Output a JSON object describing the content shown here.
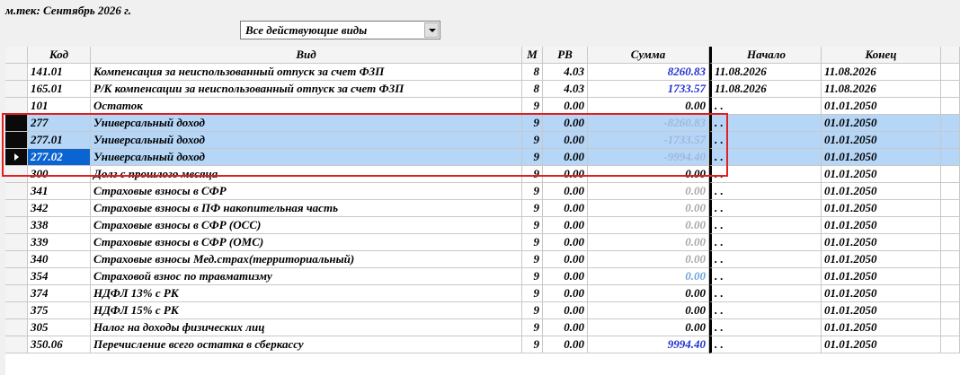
{
  "header": {
    "title": "м.тек: Сентябрь 2026 г."
  },
  "filter": {
    "selected": "Все действующие виды"
  },
  "columns": {
    "kod": "Код",
    "vid": "Вид",
    "m": "М",
    "rv": "РВ",
    "summa": "Сумма",
    "nachalo": "Начало",
    "konec": "Конец"
  },
  "rows": [
    {
      "kod": "141.01",
      "vid": "Компенсация за неиспользованный отпуск за счет ФЗП",
      "m": "8",
      "rv": "4.03",
      "summa": "8260.83",
      "nachalo": "11.08.2026",
      "konec": "11.08.2026"
    },
    {
      "kod": "165.01",
      "vid": "Р/К компенсации за неиспользованный отпуск за счет ФЗП",
      "m": "8",
      "rv": "4.03",
      "summa": "1733.57",
      "nachalo": "11.08.2026",
      "konec": "11.08.2026"
    },
    {
      "kod": "101",
      "vid": "Остаток",
      "m": "9",
      "rv": "0.00",
      "summa": "0.00",
      "nachalo": ". .",
      "konec": "01.01.2050"
    },
    {
      "kod": "277",
      "vid": "Универсальный доход",
      "m": "9",
      "rv": "0.00",
      "summa": "-8260.83",
      "nachalo": ". .",
      "konec": "01.01.2050"
    },
    {
      "kod": "277.01",
      "vid": "Универсальный доход",
      "m": "9",
      "rv": "0.00",
      "summa": "-1733.57",
      "nachalo": ". .",
      "konec": "01.01.2050"
    },
    {
      "kod": "277.02",
      "vid": "Универсальный доход",
      "m": "9",
      "rv": "0.00",
      "summa": "-9994.40",
      "nachalo": ". .",
      "konec": "01.01.2050"
    },
    {
      "kod": "300",
      "vid": "Долг с прошлого месяца",
      "m": "9",
      "rv": "0.00",
      "summa": "0.00",
      "nachalo": ". .",
      "konec": "01.01.2050"
    },
    {
      "kod": "341",
      "vid": "Страховые взносы в СФР",
      "m": "9",
      "rv": "0.00",
      "summa": "0.00",
      "nachalo": ". .",
      "konec": "01.01.2050"
    },
    {
      "kod": "342",
      "vid": "Страховые взносы в ПФ накопительная часть",
      "m": "9",
      "rv": "0.00",
      "summa": "0.00",
      "nachalo": ". .",
      "konec": "01.01.2050"
    },
    {
      "kod": "338",
      "vid": "Страховые взносы в СФР (ОСС)",
      "m": "9",
      "rv": "0.00",
      "summa": "0.00",
      "nachalo": ". .",
      "konec": "01.01.2050"
    },
    {
      "kod": "339",
      "vid": "Страховые взносы в СФР (ОМС)",
      "m": "9",
      "rv": "0.00",
      "summa": "0.00",
      "nachalo": ". .",
      "konec": "01.01.2050"
    },
    {
      "kod": "340",
      "vid": "Страховые взносы Мед.страх(территориальный)",
      "m": "9",
      "rv": "0.00",
      "summa": "0.00",
      "nachalo": ". .",
      "konec": "01.01.2050"
    },
    {
      "kod": "354",
      "vid": "Страховой взнос по травматизму",
      "m": "9",
      "rv": "0.00",
      "summa": "0.00",
      "nachalo": ". .",
      "konec": "01.01.2050"
    },
    {
      "kod": "374",
      "vid": "НДФЛ 13% с РК",
      "m": "9",
      "rv": "0.00",
      "summa": "0.00",
      "nachalo": ". .",
      "konec": "01.01.2050"
    },
    {
      "kod": "375",
      "vid": "НДФЛ 15% с РК",
      "m": "9",
      "rv": "0.00",
      "summa": "0.00",
      "nachalo": ". .",
      "konec": "01.01.2050"
    },
    {
      "kod": "305",
      "vid": "Налог на доходы физических лиц",
      "m": "9",
      "rv": "0.00",
      "summa": "0.00",
      "nachalo": ". .",
      "konec": "01.01.2050"
    },
    {
      "kod": "350.06",
      "vid": "Перечисление всего остатка в сберкассу",
      "m": "9",
      "rv": "0.00",
      "summa": "9994.40",
      "nachalo": ". .",
      "konec": "01.01.2050"
    }
  ]
}
